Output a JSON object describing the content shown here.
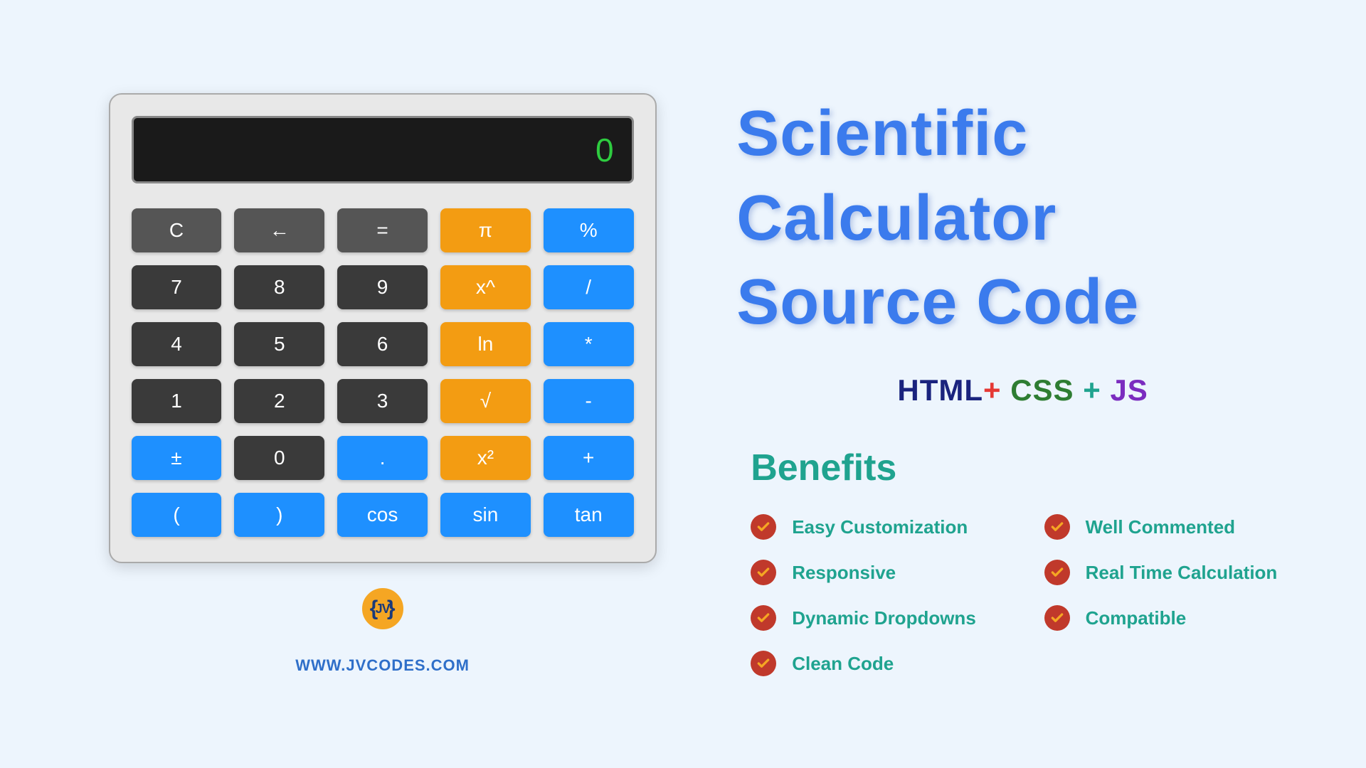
{
  "calculator": {
    "display": "0",
    "keys": [
      {
        "label": "C",
        "style": "gray"
      },
      {
        "label": "←",
        "style": "gray"
      },
      {
        "label": "=",
        "style": "gray"
      },
      {
        "label": "π",
        "style": "orange"
      },
      {
        "label": "%",
        "style": "blue"
      },
      {
        "label": "7",
        "style": "dark"
      },
      {
        "label": "8",
        "style": "dark"
      },
      {
        "label": "9",
        "style": "dark"
      },
      {
        "label": "x^",
        "style": "orange"
      },
      {
        "label": "/",
        "style": "blue"
      },
      {
        "label": "4",
        "style": "dark"
      },
      {
        "label": "5",
        "style": "dark"
      },
      {
        "label": "6",
        "style": "dark"
      },
      {
        "label": "ln",
        "style": "orange"
      },
      {
        "label": "*",
        "style": "blue"
      },
      {
        "label": "1",
        "style": "dark"
      },
      {
        "label": "2",
        "style": "dark"
      },
      {
        "label": "3",
        "style": "dark"
      },
      {
        "label": "√",
        "style": "orange"
      },
      {
        "label": "-",
        "style": "blue"
      },
      {
        "label": "±",
        "style": "blue"
      },
      {
        "label": "0",
        "style": "dark"
      },
      {
        "label": ".",
        "style": "blue"
      },
      {
        "label": "x²",
        "style": "orange"
      },
      {
        "label": "+",
        "style": "blue"
      },
      {
        "label": "(",
        "style": "blue"
      },
      {
        "label": ")",
        "style": "blue"
      },
      {
        "label": "cos",
        "style": "blue"
      },
      {
        "label": "sin",
        "style": "blue"
      },
      {
        "label": "tan",
        "style": "blue"
      }
    ]
  },
  "footer": {
    "logo_text": "JV",
    "website": "WWW.JVCODES.COM"
  },
  "title": {
    "line1": "Scientific",
    "line2": "Calculator",
    "line3": "Source Code"
  },
  "techs": {
    "html": "HTML",
    "plus1": "+ ",
    "css": "CSS ",
    "plus2": "+ ",
    "js": "JS"
  },
  "benefits": {
    "heading": "Benefits",
    "items_left": [
      "Easy Customization",
      "Responsive",
      "Dynamic Dropdowns",
      "Clean Code"
    ],
    "items_right": [
      "Well Commented",
      "Real Time Calculation",
      "Compatible"
    ]
  }
}
